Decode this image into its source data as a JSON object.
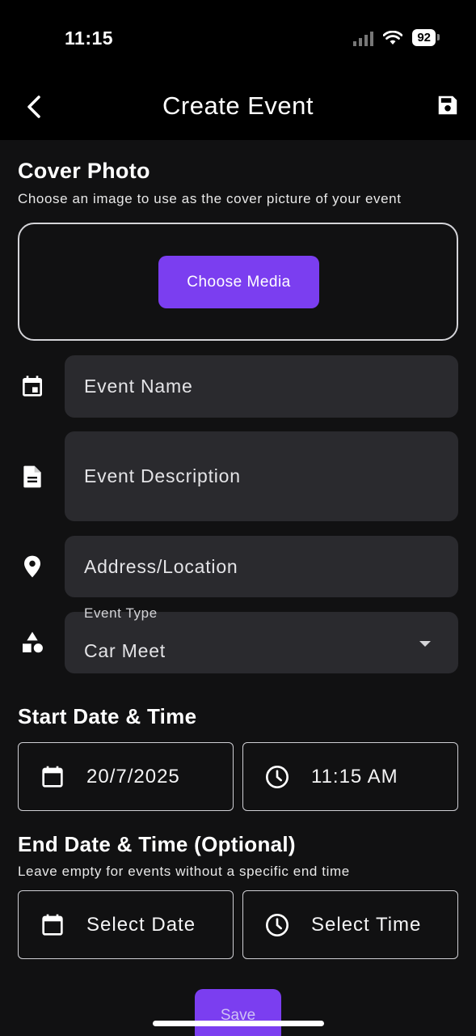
{
  "status_bar": {
    "time": "11:15",
    "battery": "92"
  },
  "app_bar": {
    "title": "Create Event"
  },
  "cover_photo": {
    "title": "Cover Photo",
    "subtitle": "Choose an image to use as the cover picture of your event",
    "button_label": "Choose Media"
  },
  "fields": {
    "event_name": {
      "placeholder": "Event Name"
    },
    "event_description": {
      "placeholder": "Event Description"
    },
    "address": {
      "placeholder": "Address/Location"
    },
    "event_type": {
      "label": "Event Type",
      "value": "Car Meet"
    }
  },
  "start": {
    "title": "Start Date & Time",
    "date": "20/7/2025",
    "time": "11:15 AM"
  },
  "end": {
    "title": "End Date & Time (Optional)",
    "subtitle": "Leave empty for events without a specific end time",
    "date": "Select Date",
    "time": "Select Time"
  },
  "save_label": "Save",
  "colors": {
    "accent": "#7b3ef0",
    "field_bg": "#2a2a2e",
    "background": "#111112"
  }
}
